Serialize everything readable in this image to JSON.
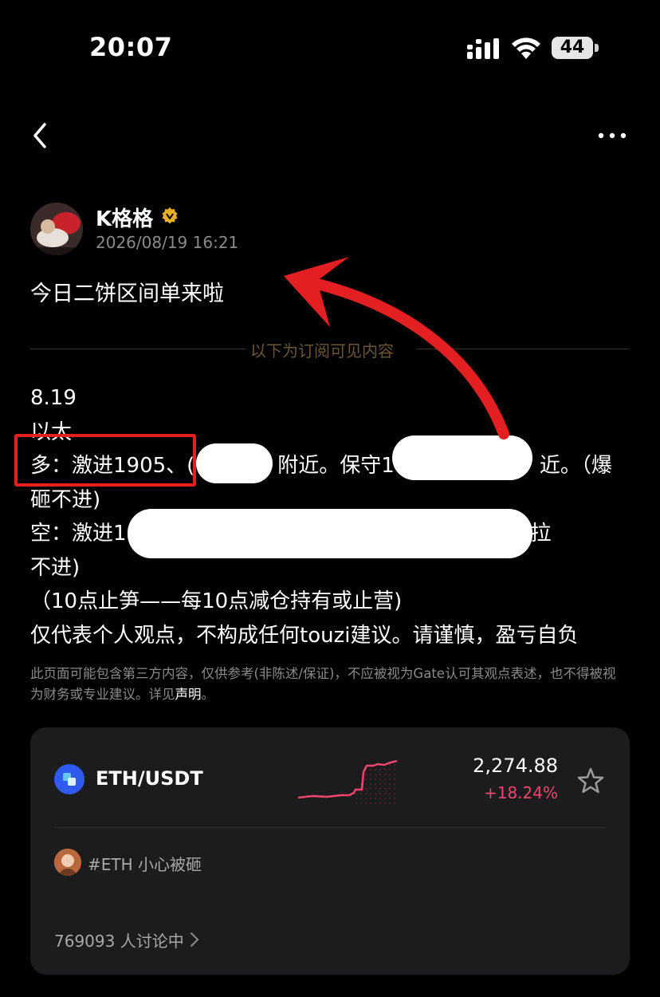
{
  "status_bar": {
    "time": "20:07",
    "battery": "44"
  },
  "author": {
    "name": "K格格",
    "date": "2026/08/19 16:21",
    "verified_icon": "verified-badge-icon"
  },
  "post": {
    "title": "今日二饼区间单来啦",
    "divider_text": "以下为订阅可见内容",
    "lines": [
      "8.19",
      "以太",
      "多：激进1905、(　　　　附近。保守1　　　　　　　近。（爆",
      "砸不进)",
      "空：激进1　　　　　　　　　　　　　　　　　。（爆拉",
      "不进)",
      "（10点止笋——每10点减仓持有或止营)",
      "仅代表个人观点，不构成任何touzi建议。请谨慎，盈亏自负"
    ]
  },
  "disclaimer": {
    "text": "此页面可能包含第三方内容，仅供参考(非陈述/保证)，不应被视为Gate认可其观点表述，也不得被视为财务或专业建议。详见",
    "link": "声明",
    "end": "。"
  },
  "ticker": {
    "pair": "ETH/USDT",
    "price": "2,274.88",
    "change": "+18.24%",
    "accent_color": "#f0466e"
  },
  "topic": {
    "label": "#ETH 小心被砸",
    "discussion": "769093 人讨论中"
  }
}
